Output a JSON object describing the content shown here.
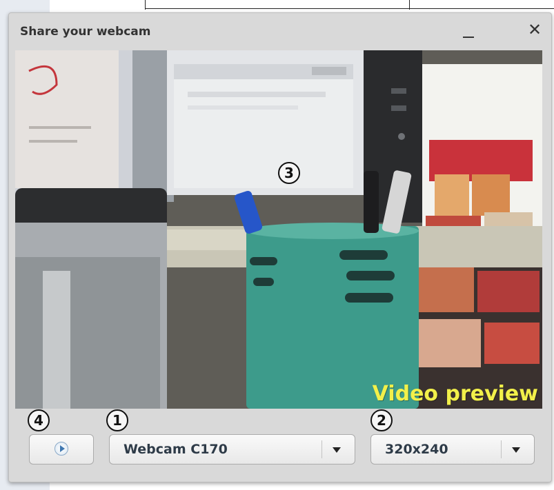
{
  "dialog": {
    "title": "Share your webcam",
    "close_glyph": "✕",
    "video_label": "Video preview"
  },
  "controls": {
    "camera_select": {
      "value": "Webcam C170"
    },
    "resolution_select": {
      "value": "320x240"
    }
  },
  "markers": {
    "camera": "1",
    "resolution": "2",
    "preview": "3",
    "start": "4"
  },
  "colors": {
    "video_label": "#f2f04a",
    "dialog_bg": "#d9d9d9"
  },
  "icons": [
    "play-icon",
    "chevron-down-icon",
    "minimize-icon",
    "close-icon"
  ]
}
